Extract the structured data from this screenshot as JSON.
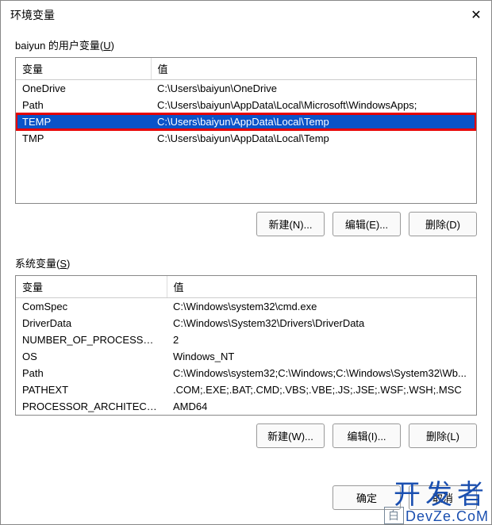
{
  "title": "环境变量",
  "close_glyph": "✕",
  "user_section": {
    "label_prefix": "baiyun 的用户变量(",
    "label_underline": "U",
    "label_suffix": ")",
    "headers": {
      "var": "变量",
      "val": "值"
    },
    "rows": [
      {
        "var": "OneDrive",
        "val": "C:\\Users\\baiyun\\OneDrive",
        "selected": false,
        "highlight": false
      },
      {
        "var": "Path",
        "val": "C:\\Users\\baiyun\\AppData\\Local\\Microsoft\\WindowsApps;",
        "selected": false,
        "highlight": false
      },
      {
        "var": "TEMP",
        "val": "C:\\Users\\baiyun\\AppData\\Local\\Temp",
        "selected": true,
        "highlight": true
      },
      {
        "var": "TMP",
        "val": "C:\\Users\\baiyun\\AppData\\Local\\Temp",
        "selected": false,
        "highlight": false
      }
    ],
    "buttons": {
      "new": "新建(N)...",
      "edit": "编辑(E)...",
      "delete": "删除(D)"
    }
  },
  "sys_section": {
    "label_prefix": "系统变量(",
    "label_underline": "S",
    "label_suffix": ")",
    "headers": {
      "var": "变量",
      "val": "值"
    },
    "rows": [
      {
        "var": "ComSpec",
        "val": "C:\\Windows\\system32\\cmd.exe"
      },
      {
        "var": "DriverData",
        "val": "C:\\Windows\\System32\\Drivers\\DriverData"
      },
      {
        "var": "NUMBER_OF_PROCESSORS",
        "val": "2"
      },
      {
        "var": "OS",
        "val": "Windows_NT"
      },
      {
        "var": "Path",
        "val": "C:\\Windows\\system32;C:\\Windows;C:\\Windows\\System32\\Wb..."
      },
      {
        "var": "PATHEXT",
        "val": ".COM;.EXE;.BAT;.CMD;.VBS;.VBE;.JS;.JSE;.WSF;.WSH;.MSC"
      },
      {
        "var": "PROCESSOR_ARCHITECT...",
        "val": "AMD64"
      }
    ],
    "buttons": {
      "new": "新建(W)...",
      "edit": "编辑(I)...",
      "delete": "删除(L)"
    }
  },
  "footer": {
    "ok": "确定",
    "cancel": "取消"
  },
  "watermark": {
    "big": "开发者",
    "small_box": "白",
    "small_text": "DevZe.CoM"
  }
}
